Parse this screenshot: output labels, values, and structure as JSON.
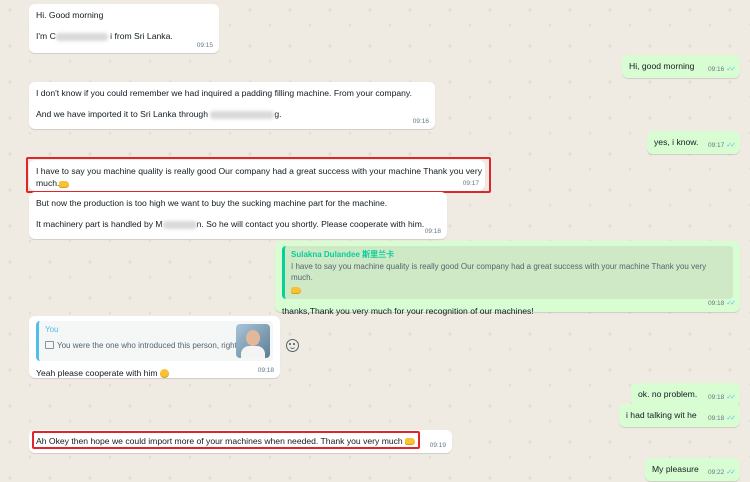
{
  "messages": {
    "m1": {
      "line1": "Hi. Good morning",
      "line2_a": "I'm C",
      "line2_b": "i from Sri Lanka.",
      "time": "09:15"
    },
    "m2": {
      "text": "Hi, good morning",
      "time": "09:16"
    },
    "m3": {
      "line1": "I don't know if you could remember we had inquired a padding filling machine. From your company.",
      "line2_a": "And we have imported it to Sri Lanka through",
      "line2_b": "g.",
      "time": "09:16"
    },
    "m4": {
      "text": "yes, i know.",
      "time": "09:17"
    },
    "m5": {
      "line1": "I have to say you machine quality is really good Our company had a great success with your machine Thank you very",
      "line2": "much.",
      "time": "09:17"
    },
    "m6": {
      "line1": "But now the production is too high we want to buy the sucking machine part for the machine.",
      "line2_a": "It machinery part is handled by M",
      "line2_b": "n. So he will contact you shortly. Please cooperate with him.",
      "time": "09:18"
    },
    "m7": {
      "quote_name": "Sulakna Dulandee 斯里兰卡",
      "quote_text": "I have to say you machine quality is really good Our company had a great success with your machine Thank you very much.",
      "text": "thanks,Thank you very much for your recognition of our machines!",
      "time": "09:18"
    },
    "m8": {
      "quote_name": "You",
      "quote_text": "You were the one who introduced this person, right?",
      "text": "Yeah please cooperate with him",
      "time": "09:18"
    },
    "m9": {
      "text": "ok. no problem.",
      "time": "09:18"
    },
    "m10": {
      "text": "i had talking wit he",
      "time": "09:18"
    },
    "m11": {
      "text": "Ah Okey then hope we could import more of your machines when needed. Thank you very much",
      "time": "09:19"
    },
    "m12": {
      "text": "My pleasure",
      "time": "09:22"
    }
  },
  "colors": {
    "incoming": "#ffffff",
    "outgoing": "#d9fdd3",
    "highlight": "#e0262d",
    "read_tick": "#53bdeb",
    "background": "#efeae2"
  },
  "icons": {
    "read": "double-check-icon",
    "reaction": "smiley-icon",
    "emoji_hand": "thumbs-hand-emoji",
    "emoji_face": "grinning-face-emoji",
    "media": "image-icon"
  }
}
